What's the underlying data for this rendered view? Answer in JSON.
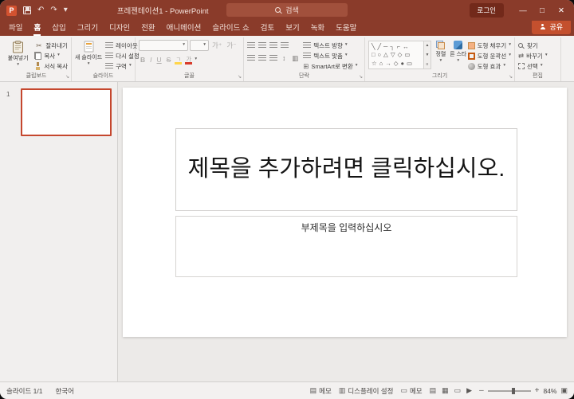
{
  "window": {
    "title": "프레젠테이션1 - PowerPoint"
  },
  "titlebar": {
    "search_label": "검색",
    "login": "로그인"
  },
  "icons": {
    "logo": "P",
    "undo": "↶",
    "redo": "↷",
    "qat_caret": "▾",
    "minimize": "—",
    "maximize": "□",
    "close": "✕",
    "caret": "▾",
    "launcher": "↘",
    "scissors": "✂",
    "grow_font": "가⁺",
    "shrink_font": "가⁻",
    "bold": "B",
    "italic": "I",
    "underline": "U",
    "strike": "S",
    "highlight": "ㄱ",
    "font_color": "가",
    "line_spacing": "↕",
    "columns": "▥",
    "smartart": "⊞",
    "gallery_up": "▲",
    "gallery_down": "▼",
    "gallery_more": "≡",
    "replace": "⇄",
    "notes": "▤",
    "display": "▥",
    "comments": "▭",
    "view_normal": "▤",
    "view_sorter": "▦",
    "view_reading": "▭",
    "view_slideshow": "▶",
    "zoom_out": "–",
    "zoom_in": "+",
    "fit": "▣"
  },
  "ribbon": {
    "tabs": [
      "파일",
      "홈",
      "삽입",
      "그리기",
      "디자인",
      "전환",
      "애니메이션",
      "슬라이드 쇼",
      "검토",
      "보기",
      "녹화",
      "도움말"
    ],
    "share": "공유",
    "clipboard": {
      "label": "클립보드",
      "paste": "붙여넣기",
      "cut": "잘라내기",
      "copy": "복사",
      "format_painter": "서식 복사"
    },
    "slides": {
      "label": "슬라이드",
      "new_slide": "새 슬라이드",
      "layout": "레이아웃",
      "reset": "다시 설정",
      "section": "구역"
    },
    "font": {
      "label": "글꼴"
    },
    "paragraph": {
      "label": "단락",
      "text_direction": "텍스트 방향",
      "align_text": "텍스트 맞춤",
      "smartart": "SmartArt로 변환"
    },
    "drawing": {
      "label": "그리기",
      "arrange": "정렬",
      "quick_styles": "빠른 스타일",
      "shape_fill": "도형 채우기",
      "shape_outline": "도형 윤곽선",
      "shape_effects": "도형 효과",
      "shape_rows": [
        "╲╱─┐⌐↔",
        "□○△▽◇▭",
        "☆⌂→◇●▭"
      ]
    },
    "editing": {
      "label": "편집",
      "find": "찾기",
      "replace": "바꾸기",
      "select": "선택"
    }
  },
  "slide_panel": {
    "slide_number": "1"
  },
  "slide": {
    "title_placeholder": "제목을 추가하려면 클릭하십시오.",
    "subtitle_placeholder": "부제목을 입력하십시오"
  },
  "statusbar": {
    "slide_indicator": "슬라이드 1/1",
    "language": "한국어",
    "notes": "메모",
    "display_settings": "디스플레이 설정",
    "comments": "메모",
    "zoom_level": "84%"
  },
  "colors": {
    "titlebar": "#8a3b2a",
    "accent": "#c4502e",
    "ribbon_bg": "#f3f1f0",
    "selected_thumb_border": "#c5472e"
  }
}
